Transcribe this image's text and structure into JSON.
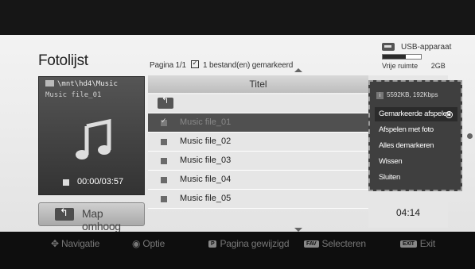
{
  "header": {
    "title": "Fotolijst",
    "page_info_prefix": "Pagina 1/1",
    "page_info_marked": "1 bestand(en) gemarkeerd"
  },
  "usb": {
    "label": "USB-apparaat",
    "free_label": "Vrije ruimte",
    "free_value": "2GB",
    "used_fraction": 0.6
  },
  "preview": {
    "path": "\\mnt\\hd4\\Music",
    "file_name": "Music file_01",
    "time": "00:00/03:57"
  },
  "up_button": {
    "label": "Map omhoog"
  },
  "list": {
    "column_title": "Titel",
    "items": [
      {
        "label": "Music file_01",
        "checked": true
      },
      {
        "label": "Music file_02",
        "checked": false
      },
      {
        "label": "Music file_03",
        "checked": false
      },
      {
        "label": "Music file_04",
        "checked": false
      },
      {
        "label": "Music file_05",
        "checked": false
      }
    ],
    "duration": "04:14"
  },
  "popup": {
    "info": "5592KB, 192Kbps",
    "options": [
      "Gemarkeerde afspelen",
      "Afspelen met foto",
      "Alles demarkeren",
      "Wissen",
      "Sluiten"
    ]
  },
  "footer": {
    "navigation": "Navigatie",
    "option": "Optie",
    "page_key": "P",
    "page_changed": "Pagina gewijzigd",
    "fav_key": "FAV",
    "select": "Selecteren",
    "exit_key": "EXIT",
    "exit": "Exit"
  }
}
